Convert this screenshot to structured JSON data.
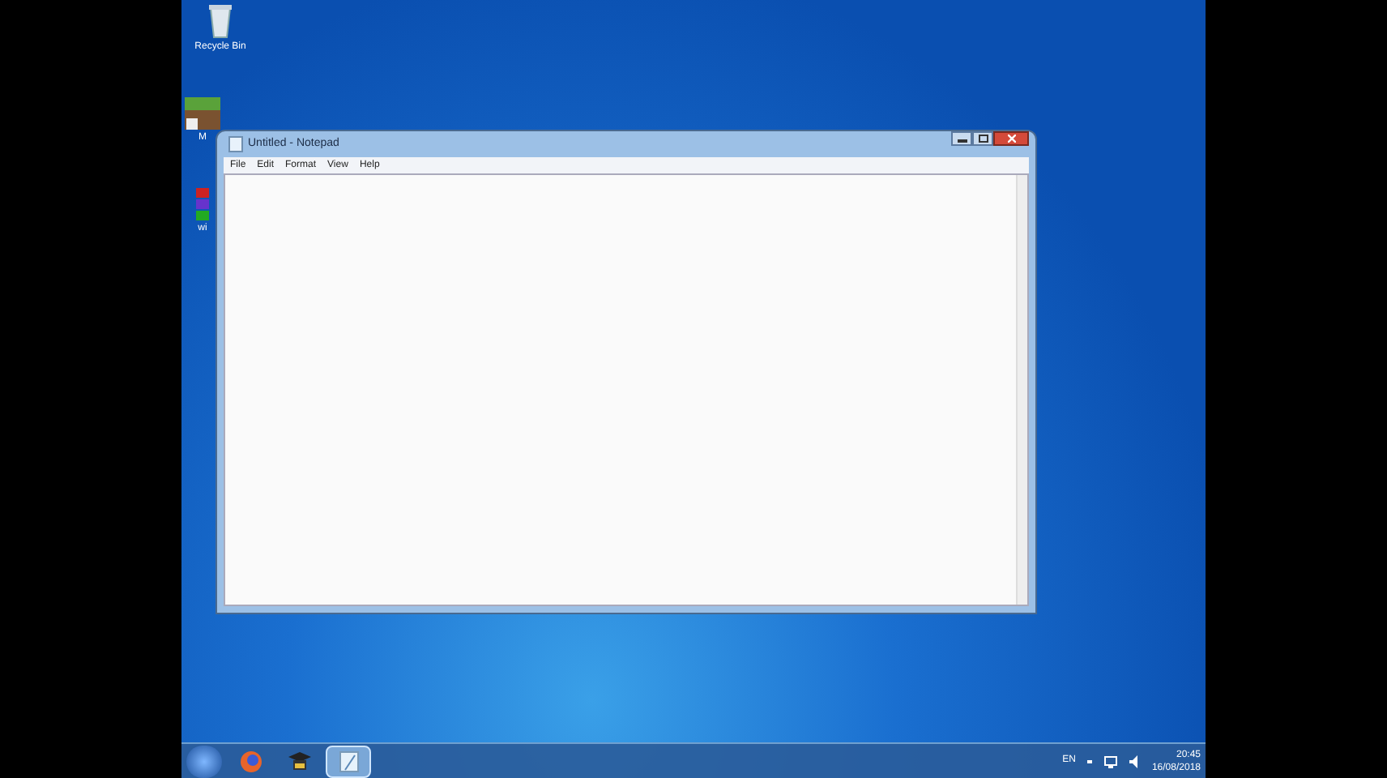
{
  "desktop": {
    "icons": [
      {
        "kind": "recycle-bin",
        "label": "Recycle Bin"
      },
      {
        "kind": "block",
        "label": "M"
      },
      {
        "kind": "stack",
        "label": "wi"
      }
    ]
  },
  "window": {
    "title": "Untitled - Notepad",
    "menu": [
      "File",
      "Edit",
      "Format",
      "View",
      "Help"
    ]
  },
  "taskbar": {
    "items": [
      {
        "kind": "browser",
        "selected": false
      },
      {
        "kind": "app",
        "selected": false
      },
      {
        "kind": "notepad",
        "selected": true
      }
    ],
    "tray": {
      "language": "EN",
      "time": "20:45",
      "date": "16/08/2018"
    }
  }
}
